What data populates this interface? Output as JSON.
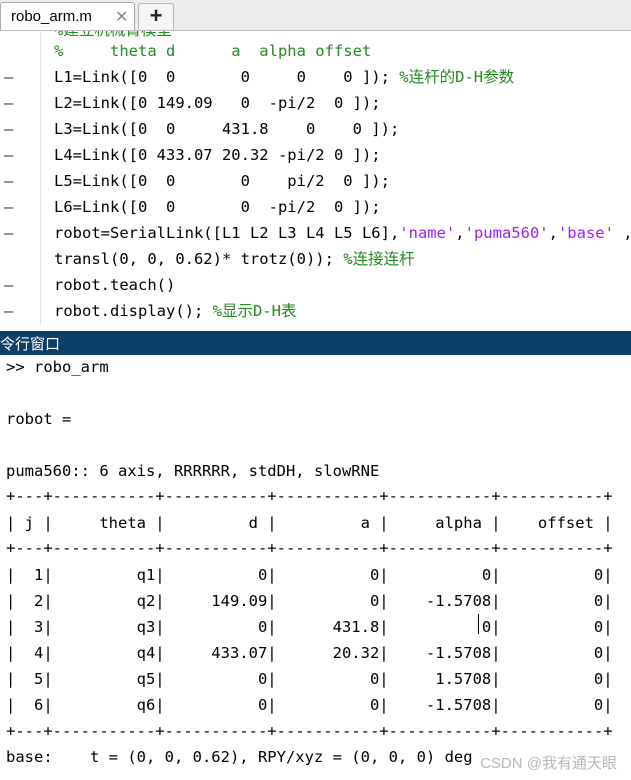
{
  "tab": {
    "title": "robo_arm.m",
    "close": "✕",
    "add": "+"
  },
  "editor": {
    "cut_line": "%建立机械臂模型",
    "lines": [
      {
        "dash": "",
        "parts": [
          {
            "t": "%     theta d      a  alpha offset",
            "c": "cm"
          }
        ]
      },
      {
        "dash": "—",
        "parts": [
          {
            "t": "L1=Link([0  0       0     0    0 ]); ",
            "c": ""
          },
          {
            "t": "%连杆的D-H参数",
            "c": "cm"
          }
        ]
      },
      {
        "dash": "—",
        "parts": [
          {
            "t": "L2=Link([0 149.09   0  -pi/2  0 ]);",
            "c": ""
          }
        ]
      },
      {
        "dash": "—",
        "parts": [
          {
            "t": "L3=Link([0  0     431.8    0    0 ]);",
            "c": ""
          }
        ]
      },
      {
        "dash": "—",
        "parts": [
          {
            "t": "L4=Link([0 433.07 20.32 -pi/2 0 ]);",
            "c": ""
          }
        ]
      },
      {
        "dash": "—",
        "parts": [
          {
            "t": "L5=Link([0  0       0    pi/2  0 ]);",
            "c": ""
          }
        ]
      },
      {
        "dash": "—",
        "parts": [
          {
            "t": "L6=Link([0  0       0  -pi/2  0 ]);",
            "c": ""
          }
        ]
      },
      {
        "dash": "—",
        "parts": [
          {
            "t": "robot=SerialLink([L1 L2 L3 L4 L5 L6],",
            "c": ""
          },
          {
            "t": "'name'",
            "c": "str"
          },
          {
            "t": ",",
            "c": ""
          },
          {
            "t": "'puma560'",
            "c": "str"
          },
          {
            "t": ",",
            "c": ""
          },
          {
            "t": "'base'",
            "c": "str"
          },
          {
            "t": " , ...",
            "c": ""
          }
        ]
      },
      {
        "dash": "",
        "parts": [
          {
            "t": "transl(0, 0, 0.62)* trotz(0)); ",
            "c": ""
          },
          {
            "t": "%连接连杆",
            "c": "cm"
          }
        ]
      },
      {
        "dash": "—",
        "parts": [
          {
            "t": "robot.teach()",
            "c": ""
          }
        ]
      },
      {
        "dash": "—",
        "parts": [
          {
            "t": "robot.display(); ",
            "c": ""
          },
          {
            "t": "%显示D-H表",
            "c": "cm"
          }
        ]
      }
    ]
  },
  "console": {
    "title": "令行窗口",
    "prompt_line": ">> robo_arm",
    "robot_eq": "robot =",
    "summary": "puma560:: 6 axis, RRRRRR, stdDH, slowRNE",
    "table_rule": "+---+-----------+-----------+-----------+-----------+-----------+",
    "header_line": "| j |     theta |         d |         a |     alpha |    offset |",
    "rows": [
      "|  1|         q1|          0|          0|          0|          0|",
      "|  2|         q2|     149.09|          0|    -1.5708|          0|",
      "|  3|         q3|          0|      431.8|          0|          0|",
      "|  4|         q4|     433.07|      20.32|    -1.5708|          0|",
      "|  5|         q5|          0|          0|     1.5708|          0|",
      "|  6|         q6|          0|          0|    -1.5708|          0|"
    ],
    "base_line": "base:    t = (0, 0, 0.62), RPY/xyz = (0, 0, 0) deg"
  },
  "watermark": "CSDN @我有通天眼"
}
